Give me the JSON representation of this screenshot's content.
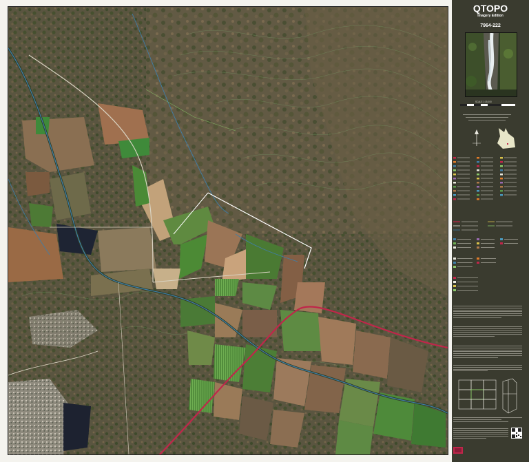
{
  "map": {
    "title": "QTOPO",
    "edition": "Imagery Edition",
    "sheet_number": "7964-222",
    "scale": "SCALE 1:15,000"
  },
  "colors": {
    "panel_background": "#3a3b2f",
    "road_major": "#c0264a",
    "watercourse": "#3f7ea8",
    "boundary": "#ffffff",
    "contour": "#7aa06a"
  },
  "icons": {
    "north_arrow": "north-arrow-icon",
    "location_map": "queensland-locator-icon",
    "qr_code": "qr-code-icon"
  }
}
